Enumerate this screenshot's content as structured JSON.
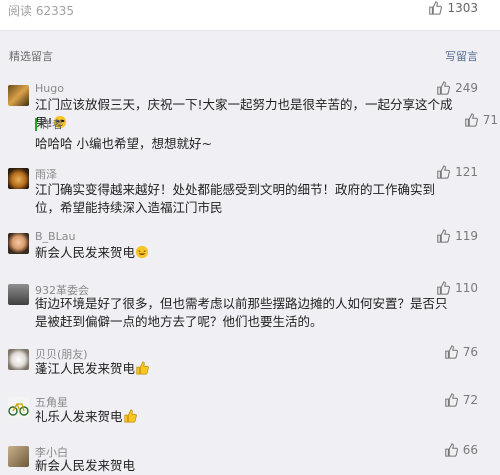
{
  "header": {
    "read_count": "阅读 62335",
    "like_count": "1303"
  },
  "section": {
    "title": "精选留言",
    "write_label": "写留言"
  },
  "comments": [
    {
      "nickname": "Hugo",
      "likes": "249",
      "text": "江门应该放假三天，庆祝一下!大家一起努力也是很辛苦的，一起分享这个成果!",
      "reply": {
        "author": "作者",
        "text": "哈哈哈 小编也希望，想想就好~",
        "likes": "71"
      }
    },
    {
      "nickname": "雨泽",
      "likes": "121",
      "text": "江门确实变得越来越好！处处都能感受到文明的细节！政府的工作确实到位，希望能持续深入造福江门市民"
    },
    {
      "nickname": "B_BLau",
      "likes": "119",
      "text": "新会人民发来贺电"
    },
    {
      "nickname": "932革委会",
      "likes": "110",
      "text": "街边环境是好了很多，但也需考虑以前那些摆路边摊的人如何安置？是否只是被赶到偏僻一点的地方去了呢？他们也要生活的。"
    },
    {
      "nickname": "贝贝(朋友)",
      "likes": "76",
      "text": "蓬江人民发来贺电"
    },
    {
      "nickname": "五角星",
      "likes": "72",
      "text": "礼乐人发来贺电"
    },
    {
      "nickname": "李小白",
      "likes": "66",
      "text": "新会人民发来贺电"
    }
  ]
}
